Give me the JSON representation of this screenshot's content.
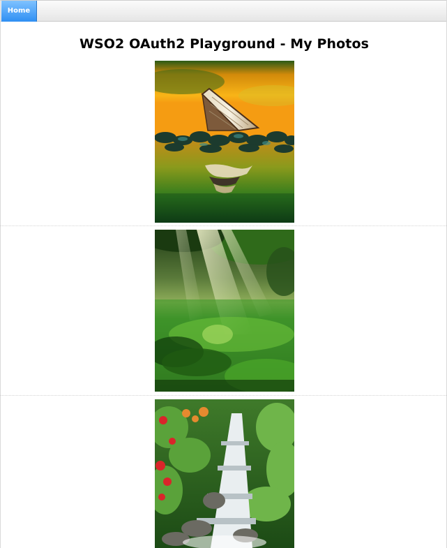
{
  "nav": {
    "home_label": "Home"
  },
  "page": {
    "title": "WSO2 OAuth2 Playground - My Photos"
  },
  "photos": [
    {
      "name": "boat-at-sunset-photo"
    },
    {
      "name": "sunlit-forest-clearing-photo"
    },
    {
      "name": "jungle-waterfall-photo"
    }
  ],
  "colors": {
    "nav_accent": "#2f8ff3",
    "nav_bar": "#ececec",
    "title_text": "#000000"
  }
}
